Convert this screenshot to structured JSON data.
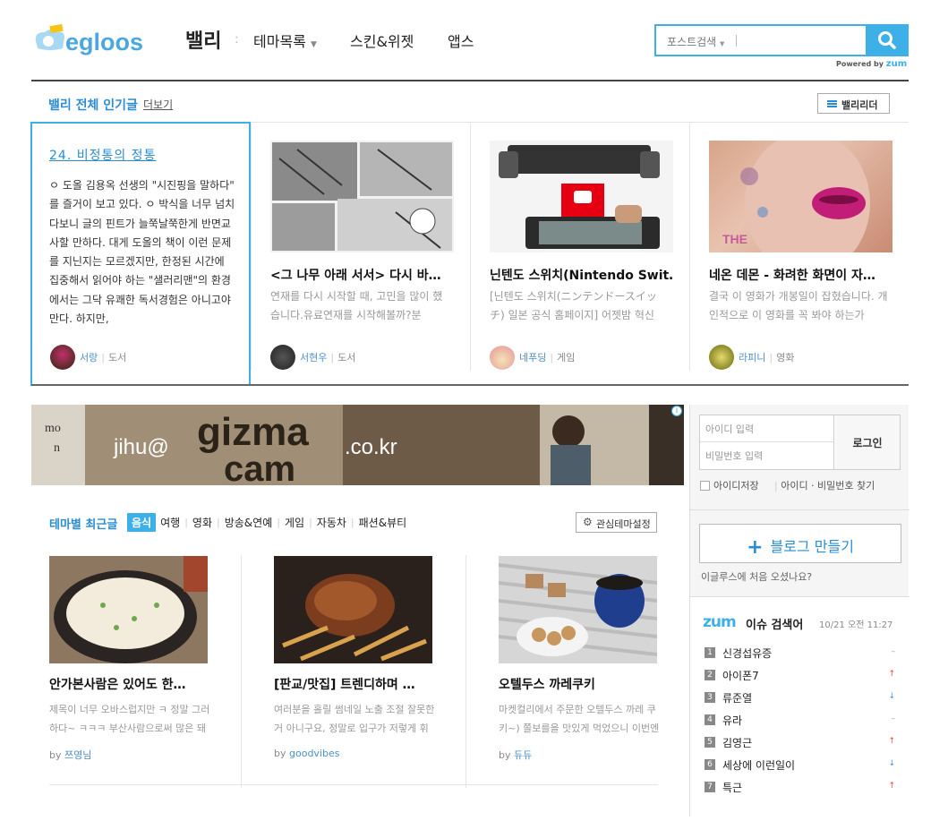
{
  "header": {
    "logo_text": "egloos",
    "nav": {
      "valley": "밸리",
      "sep": ":",
      "themes": "테마목록",
      "skins": "스킨&위젯",
      "apps": "앱스"
    },
    "search": {
      "scope": "포스트검색",
      "powered_by": "Powered by",
      "powered_brand": "zum"
    }
  },
  "popular": {
    "title": "밸리 전체 인기글",
    "more": "더보기",
    "leader_button": "밸리리더",
    "featured": {
      "title": "24. 비정통의 정통",
      "body": "ㅇ 도올 김용옥 선생의 \"시진핑을 말하다\" 를 즐거이 보고 있다. ㅇ 박식을 너무 넘치다보니 글의 핀트가 늘쭉날쭉한게 반면교사할 만하다. 대게 도올의 책이 이런 문제를 지닌지는 모르겠지만, 한정된 시간에 집중해서 읽어야 하는 \"샐러리맨\"의 환경에서는 그닥 유쾌한 독서경험은 아니고야 만다. 하지만,",
      "author": "서랑",
      "category": "도서"
    },
    "items": [
      {
        "title": "<그 나무 아래 서서> 다시 바…",
        "desc": "연재를 다시 시작할 때, 고민을 많이 했습니다.유료연재를 시작해볼까?분",
        "author": "서현우",
        "category": "도서"
      },
      {
        "title": "닌텐도 스위치(Nintendo Swit…",
        "desc": "[닌텐도 스위치(ニンテンドースイッチ) 일본 공식 홈페이지] 어젯밤 혁신",
        "author": "네푸딩",
        "category": "게임"
      },
      {
        "title": "네온 데몬 - 화려한 화면이 자…",
        "desc": "결국 이 영화가 개봉일이 잡혔습니다. 개인적으로 이 영화를 꼭 봐야 하는가",
        "author": "라피니",
        "category": "영화"
      }
    ]
  },
  "ad": {
    "left": "jihu@",
    "brand": "gizma",
    "brand2": "cam",
    "right": ".co.kr",
    "corner": "i",
    "img_top": "mo",
    "img_bottom": "n"
  },
  "theme": {
    "title": "테마별 최근글",
    "tabs": [
      "음식",
      "여행",
      "영화",
      "방송&연예",
      "게임",
      "자동차",
      "패션&뷰티"
    ],
    "interest_button": "관심테마설정",
    "items": [
      {
        "title": "안가본사람은 있어도 한…",
        "desc": "제목이 너무 오바스럽지만 ㅋ 정말 그러하다~ ㅋㅋㅋ 부산사람으로써 많은 돼지",
        "by": "by",
        "author": "쯔영님"
      },
      {
        "title": "[판교/맛집] 트렌디하며 …",
        "desc": "여러분을 홀릴 썸네일 노출 조절 잘못한거 아니구요, 정말로 입구가 저렇게 휘",
        "by": "by",
        "author": "goodvibes"
      },
      {
        "title": "오텔두스 까레쿠키",
        "desc": "마켓컬리에서 주문한 오텔두스 까레 쿠키~) 쫄보를을 맛있게 먹었으니 이번엔",
        "by": "by",
        "author": "듀듀"
      }
    ]
  },
  "login": {
    "id_placeholder": "아이디 입력",
    "pw_placeholder": "비밀번호 입력",
    "button": "로그인",
    "save_id": "아이디저장",
    "find": "아이디 · 비밀번호 찾기"
  },
  "make_blog": {
    "plus": "+",
    "label": "블로그 만들기",
    "first_visit": "이글루스에 처음 오셨나요?"
  },
  "issues": {
    "logo": "zum",
    "title": "이슈 검색어",
    "time": "10/21 오전 11:27",
    "list": [
      {
        "rank": "1",
        "term": "신경섭유증",
        "trend": "same",
        "mark": "–"
      },
      {
        "rank": "2",
        "term": "아이폰7",
        "trend": "up",
        "mark": "↑"
      },
      {
        "rank": "3",
        "term": "류준열",
        "trend": "down",
        "mark": "↓"
      },
      {
        "rank": "4",
        "term": "유라",
        "trend": "same",
        "mark": "–"
      },
      {
        "rank": "5",
        "term": "김영근",
        "trend": "up",
        "mark": "↑"
      },
      {
        "rank": "6",
        "term": "세상에 이런일이",
        "trend": "down",
        "mark": "↓"
      },
      {
        "rank": "7",
        "term": "특근",
        "trend": "up",
        "mark": "↑"
      }
    ]
  },
  "colors": {
    "accent": "#3db0e8",
    "link": "#2a8dd4"
  }
}
